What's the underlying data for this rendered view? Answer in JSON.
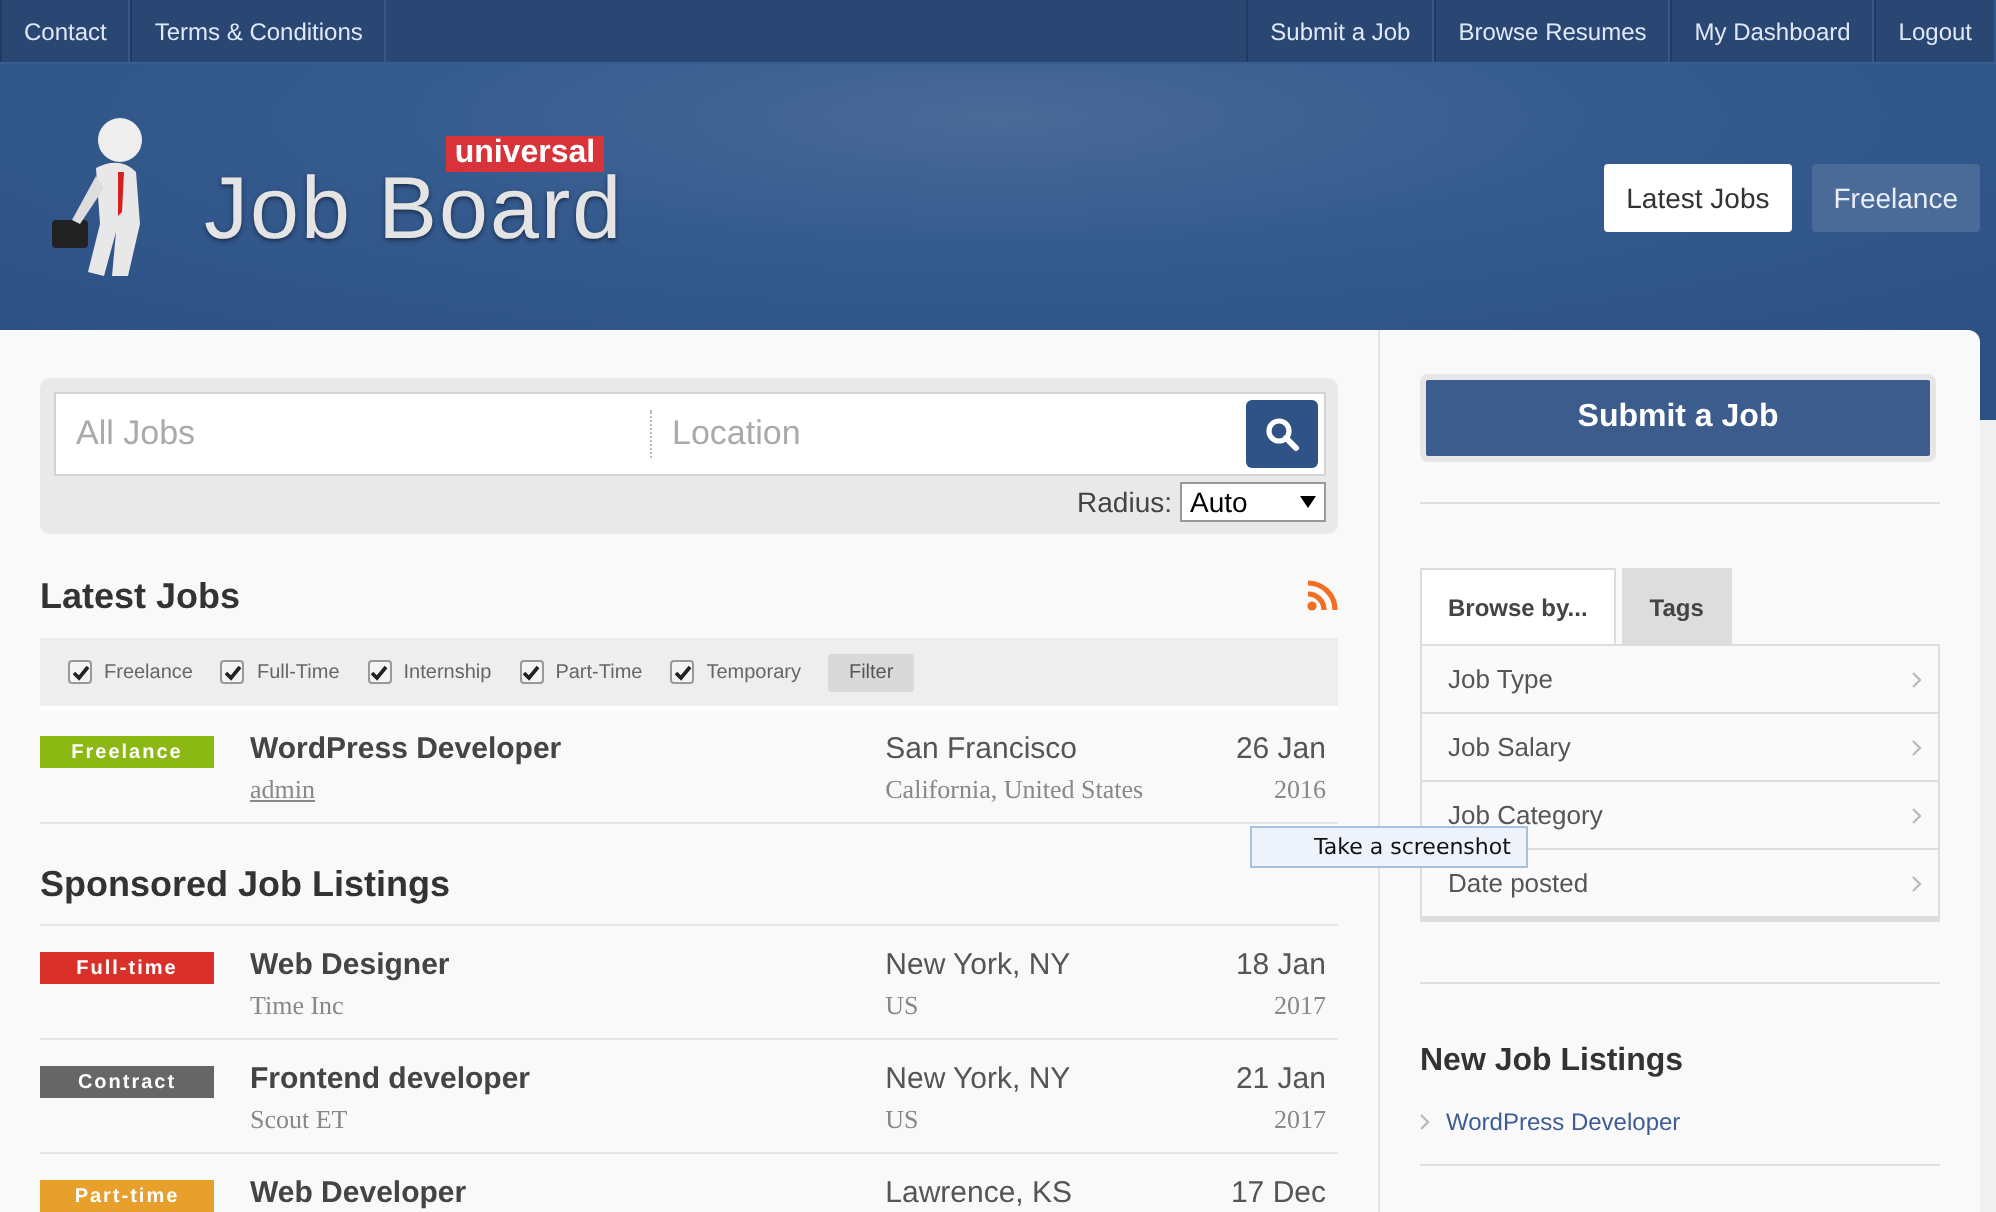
{
  "top_nav": {
    "left": [
      "Contact",
      "Terms & Conditions"
    ],
    "right": [
      "Submit a Job",
      "Browse Resumes",
      "My Dashboard",
      "Logout"
    ]
  },
  "logo": {
    "title": "Job Board",
    "badge": "universal"
  },
  "header_tabs": [
    {
      "label": "Latest Jobs",
      "selected": true
    },
    {
      "label": "Freelance",
      "selected": false
    }
  ],
  "search": {
    "keywords_placeholder": "All Jobs",
    "location_placeholder": "Location",
    "radius_label": "Radius:",
    "radius_value": "Auto"
  },
  "latest_jobs": {
    "title": "Latest Jobs",
    "filters": [
      {
        "label": "Freelance",
        "checked": true
      },
      {
        "label": "Full-Time",
        "checked": true
      },
      {
        "label": "Internship",
        "checked": true
      },
      {
        "label": "Part-Time",
        "checked": true
      },
      {
        "label": "Temporary",
        "checked": true
      }
    ],
    "filter_button": "Filter",
    "jobs": [
      {
        "type": "Freelance",
        "color": "#8cb813",
        "title": "WordPress Developer",
        "company": "admin",
        "company_link": true,
        "city": "San Francisco",
        "region": "California, United States",
        "date": "26 Jan",
        "year": "2016"
      }
    ]
  },
  "sponsored": {
    "title": "Sponsored Job Listings",
    "jobs": [
      {
        "type": "Full-time",
        "color": "#d9302a",
        "title": "Web Designer",
        "company": "Time Inc",
        "company_link": false,
        "city": "New York, NY",
        "region": "US",
        "date": "18 Jan",
        "year": "2017"
      },
      {
        "type": "Contract",
        "color": "#666666",
        "title": "Frontend developer",
        "company": "Scout ET",
        "company_link": false,
        "city": "New York, NY",
        "region": "US",
        "date": "21 Jan",
        "year": "2017"
      },
      {
        "type": "Part-time",
        "color": "#e8a02c",
        "title": "Web Developer",
        "city": "Lawrence, KS",
        "date": "17 Dec"
      }
    ]
  },
  "sidebar": {
    "submit_button": "Submit a Job",
    "browse_tabs": [
      {
        "label": "Browse by...",
        "selected": true
      },
      {
        "label": "Tags",
        "selected": false
      }
    ],
    "browse_items": [
      "Job Type",
      "Job Salary",
      "Job Category",
      "Date posted"
    ],
    "new_listings_title": "New Job Listings",
    "new_listings": [
      "WordPress Developer"
    ]
  },
  "tooltip": "Take a screenshot"
}
